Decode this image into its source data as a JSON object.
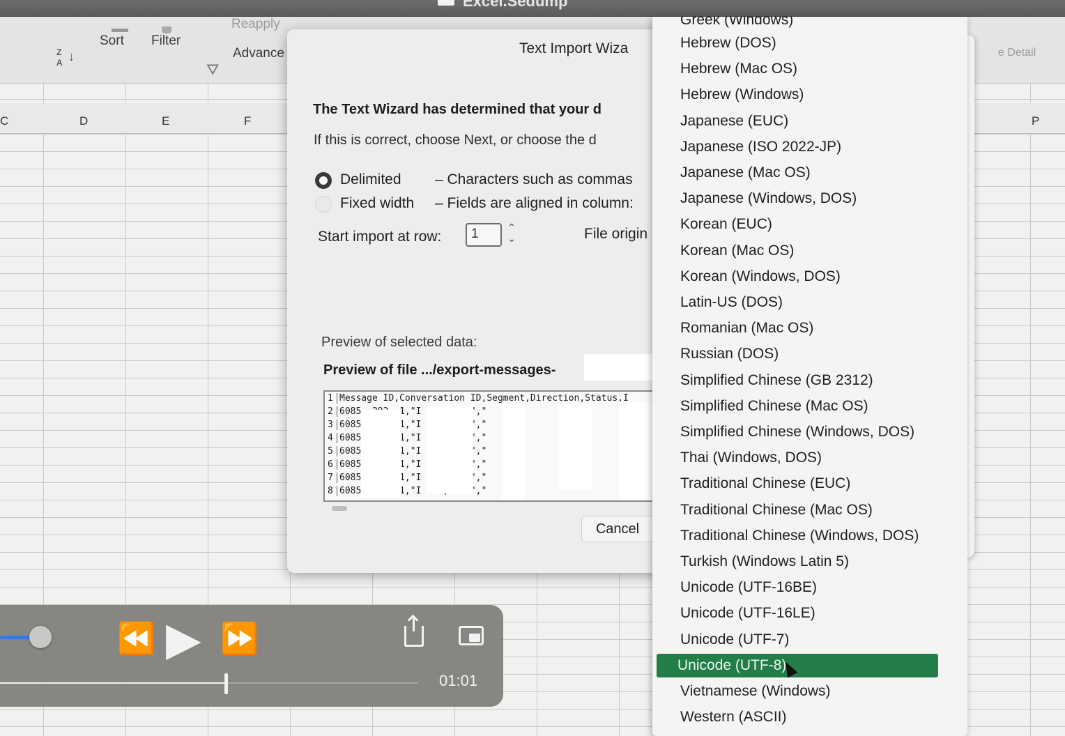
{
  "window": {
    "title": "Excel.Sedump",
    "doc_icon": "document-icon"
  },
  "ribbon": {
    "sort_icon": "sort-za-icon",
    "sort_icon_letters": [
      "Z",
      "A"
    ],
    "sort_label": "Sort",
    "filter_label": "Filter",
    "reapply_label": "Reapply",
    "advanced_label": "Advance",
    "right_label": "e Detail"
  },
  "sheet": {
    "columns": [
      "C",
      "D",
      "E",
      "F",
      "P"
    ]
  },
  "dialog": {
    "title": "Text Import Wiza",
    "heading": "The Text Wizard has determined that your d",
    "subtext": "If this is correct, choose Next, or choose the d",
    "radio_delimited": {
      "label": "Delimited",
      "desc": "– Characters such as commas",
      "selected": true
    },
    "radio_fixed": {
      "label": "Fixed width",
      "desc": "– Fields are aligned in column:",
      "selected": false
    },
    "start_row_label": "Start import at row:",
    "start_row_value": "1",
    "file_origin_label": "File origin",
    "preview_label": "Preview of selected data:",
    "preview_file": "Preview of file .../export-messages-",
    "preview_rows": [
      {
        "n": "1",
        "text": "Message ID,Conversation ID,Segment,Direction,Status,I"
      },
      {
        "n": "2",
        "text": "6085       ,292      ,1,\"I  nd\",\"A      d\",\""
      },
      {
        "n": "3",
        "text": "6085       ,292      ,1,\"I  nd\",\"A      d\",\""
      },
      {
        "n": "4",
        "text": "6085       ,292      ,1,\"I  nd\",\"A      d\",\""
      },
      {
        "n": "5",
        "text": "6085       ,292      ,1,\"I  nd\",\"A      d\",\""
      },
      {
        "n": "6",
        "text": "6085       ,292      ,1,\"I  nd\",\"A      d\",\""
      },
      {
        "n": "7",
        "text": "6085       ,292      ,1,\"I  nd\",\"A      d\",\""
      },
      {
        "n": "8",
        "text": "6085       ,292      ,1,\"I  nd\",\"A      d\",\""
      }
    ],
    "cancel_label": "Cancel"
  },
  "encoding_list": {
    "partial_top": "Greek (Windows)",
    "items": [
      "Hebrew (DOS)",
      "Hebrew (Mac OS)",
      "Hebrew (Windows)",
      "Japanese (EUC)",
      "Japanese (ISO 2022-JP)",
      "Japanese (Mac OS)",
      "Japanese (Windows, DOS)",
      "Korean (EUC)",
      "Korean (Mac OS)",
      "Korean (Windows, DOS)",
      "Latin-US (DOS)",
      "Romanian (Mac OS)",
      "Russian (DOS)",
      "Simplified Chinese (GB 2312)",
      "Simplified Chinese (Mac OS)",
      "Simplified Chinese (Windows, DOS)",
      "Thai (Windows, DOS)",
      "Traditional Chinese (EUC)",
      "Traditional Chinese (Mac OS)",
      "Traditional Chinese (Windows, DOS)",
      "Turkish (Windows Latin 5)",
      "Unicode (UTF-16BE)",
      "Unicode (UTF-16LE)",
      "Unicode (UTF-7)",
      "Unicode (UTF-8)",
      "Vietnamese (Windows)",
      "Western (ASCII)"
    ],
    "selected": "Unicode (UTF-8)",
    "selected_color": "#227d48"
  },
  "player": {
    "time": "01:01",
    "progress_fraction": 0.54,
    "volume_fraction": 1.0,
    "icons": {
      "rewind": "⏪",
      "play": "▶",
      "forward": "⏩",
      "share": "share-icon",
      "pip": "picture-in-picture-icon"
    },
    "accent_color": "#2c7bf2"
  }
}
